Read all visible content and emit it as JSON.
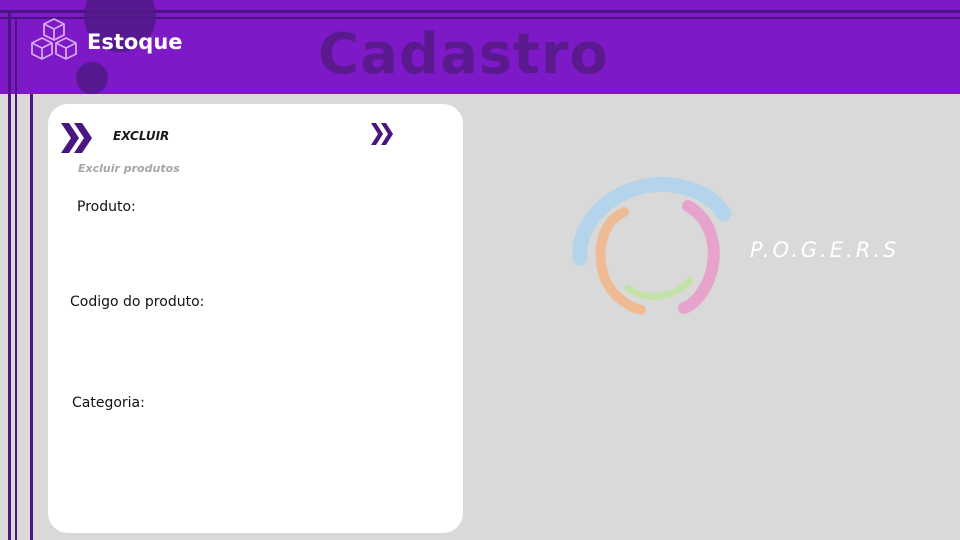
{
  "header": {
    "brand": "Estoque",
    "ghost_title": "Cadastro"
  },
  "form": {
    "section_title": "EXCLUIR",
    "section_subtitle": "Excluir  produtos",
    "fields": [
      {
        "label": "Produto:",
        "value": ""
      },
      {
        "label": "Codigo do produto:",
        "value": ""
      },
      {
        "label": "Categoria:",
        "value": ""
      }
    ]
  },
  "logo": {
    "text": "P.O.G.E.R.S"
  },
  "icons": [
    "boxes-icon",
    "double-chevron-right-icon",
    "double-chevron-right-icon",
    "pogers-swirl-logo"
  ],
  "colors": {
    "header": "#7d19c6",
    "header_dark": "#4a1580",
    "background": "#d9d9d9",
    "card": "#ffffff",
    "chevron": "#4a1580"
  }
}
